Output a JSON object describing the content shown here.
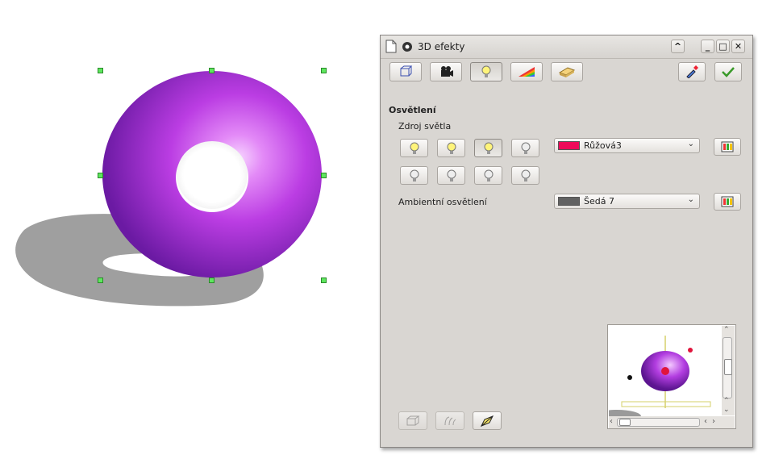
{
  "dialog": {
    "title": "3D efekty",
    "section_heading": "Osvětlení",
    "light_source_label": "Zdroj světla",
    "ambient_label": "Ambientní osvětlení",
    "light_color": {
      "value": "Růžová3",
      "swatch": "#ee0a5a"
    },
    "ambient_color": {
      "value": "Šedá 7",
      "swatch": "#626262"
    },
    "toolbar_icons": [
      "geometry-icon",
      "shading-icon",
      "illumination-icon",
      "textures-icon",
      "material-icon"
    ],
    "right_icons": [
      "assign-icon",
      "update-icon"
    ],
    "light_buttons_row1": [
      "light-1-icon",
      "light-2-icon",
      "light-3-icon",
      "light-4-icon"
    ],
    "light_buttons_row2": [
      "light-5-icon",
      "light-6-icon",
      "light-7-icon",
      "light-8-icon"
    ]
  },
  "colors": {
    "torus": "#b43ee0",
    "shadow": "#9a9a9a",
    "handle": "#5ee65e"
  }
}
